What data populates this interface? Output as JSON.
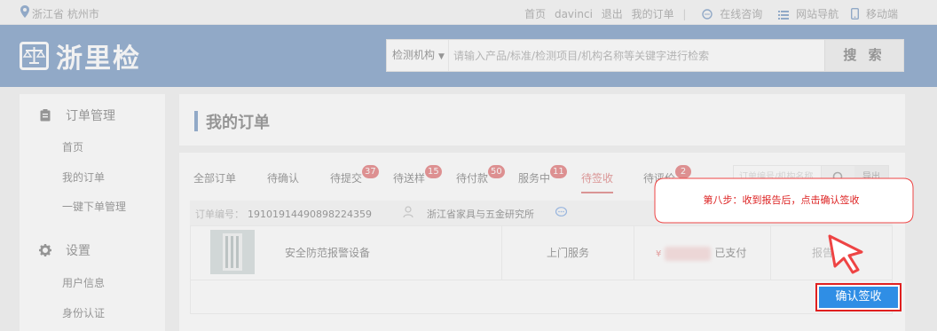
{
  "topbar": {
    "location": "浙江省 杭州市",
    "links": [
      "首页",
      "davinci",
      "退出",
      "我的订单"
    ],
    "consult": "在线咨询",
    "nav": "网站导航",
    "mobile": "移动端"
  },
  "header": {
    "logo_text": "浙里检",
    "search": {
      "category": "检测机构",
      "placeholder": "请输入产品/标准/检测项目/机构名称等关键字进行检索",
      "button": "搜 索"
    }
  },
  "sidebar": {
    "sections": [
      {
        "title": "订单管理",
        "icon": "clipboard-icon",
        "items": [
          "首页",
          "我的订单",
          "一键下单管理"
        ]
      },
      {
        "title": "设置",
        "icon": "gear-icon",
        "items": [
          "用户信息",
          "身份认证"
        ]
      }
    ]
  },
  "main": {
    "title": "我的订单",
    "tabs": [
      {
        "label": "全部订单",
        "badge": null
      },
      {
        "label": "待确认",
        "badge": null
      },
      {
        "label": "待提交",
        "badge": "37"
      },
      {
        "label": "待送样",
        "badge": "15"
      },
      {
        "label": "待付款",
        "badge": "50"
      },
      {
        "label": "服务中",
        "badge": "11"
      },
      {
        "label": "待签收",
        "badge": null
      },
      {
        "label": "待评价",
        "badge": "2"
      }
    ],
    "active_tab": "待签收",
    "search_placeholder": "订单编号/机构名称",
    "search_export": "导出",
    "order": {
      "number_label": "订单编号：",
      "number": "19101914490898224359",
      "org": "浙江省家具与五金研究所",
      "product": "安全防范报警设备",
      "service": "上门服务",
      "currency": "¥",
      "status": "已支付",
      "report": "报告",
      "action": "确认签收"
    }
  },
  "callout": {
    "text": "第八步：收到报告后，点击确认签收"
  },
  "colors": {
    "brand": "#2c5fa2",
    "badge": "#d3292b",
    "confirm": "#2f8ee5",
    "highlight": "#e02020"
  }
}
